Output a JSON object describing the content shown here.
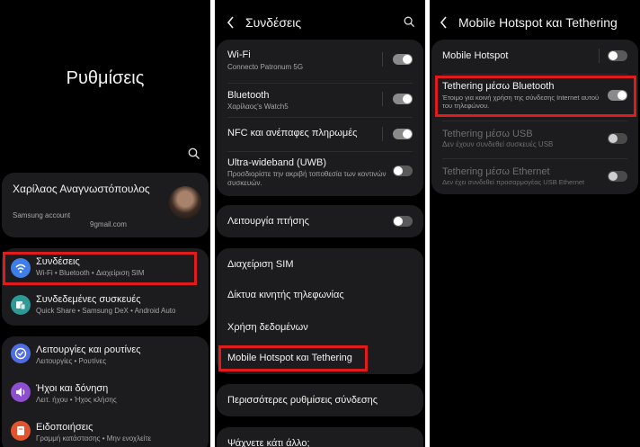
{
  "panel1": {
    "title": "Ρυθμίσεις",
    "account": {
      "name": "Χαρίλαος Αναγνωστόπουλος",
      "account_label": "Samsung account",
      "email": "9gmail.com"
    },
    "items": [
      {
        "title": "Συνδέσεις",
        "subtitle": "Wi-Fi • Bluetooth • Διαχείριση SIM",
        "icon": "wifi-icon",
        "color": "#3f7ee8"
      },
      {
        "title": "Συνδεδεμένες συσκευές",
        "subtitle": "Quick Share • Samsung DeX • Android Auto",
        "icon": "devices-icon",
        "color": "#2e9a96"
      },
      {
        "title": "Λειτουργίες και ρουτίνες",
        "subtitle": "Λειτουργίες • Ρουτίνες",
        "icon": "check-icon",
        "color": "#4f6de0"
      },
      {
        "title": "Ήχοι και δόνηση",
        "subtitle": "Λειτ. ήχου • Ήχος κλήσης",
        "icon": "sound-icon",
        "color": "#8d4fd0"
      },
      {
        "title": "Ειδοποιήσεις",
        "subtitle": "Γραμμή κατάστασης • Μην ενοχλείτε",
        "icon": "notification-icon",
        "color": "#e0542e"
      }
    ]
  },
  "panel2": {
    "header": "Συνδέσεις",
    "items": [
      {
        "title": "Wi-Fi",
        "subtitle": "Connecto Patronum 5G",
        "toggle": "on"
      },
      {
        "title": "Bluetooth",
        "subtitle": "Χαρίλαος's Watch5",
        "toggle": "on"
      },
      {
        "title": "NFC και ανέπαφες πληρωμές",
        "subtitle": "",
        "toggle": "on"
      },
      {
        "title": "Ultra-wideband (UWB)",
        "subtitle": "Προσδιορίστε την ακριβή τοποθεσία των κοντινών συσκευών.",
        "toggle": "off"
      },
      {
        "title": "Λειτουργία πτήσης",
        "subtitle": "",
        "toggle": "off"
      },
      {
        "title": "Διαχείριση SIM"
      },
      {
        "title": "Δίκτυα κινητής τηλεφωνίας"
      },
      {
        "title": "Χρήση δεδομένων"
      },
      {
        "title": "Mobile Hotspot και Tethering"
      },
      {
        "title": "Περισσότερες ρυθμίσεις σύνδεσης"
      },
      {
        "title": "Ψάχνετε κάτι άλλο;"
      }
    ]
  },
  "panel3": {
    "header": "Mobile Hotspot και Tethering",
    "items": [
      {
        "title": "Mobile Hotspot",
        "subtitle": "",
        "toggle": "off"
      },
      {
        "title": "Tethering μέσω Bluetooth",
        "subtitle": "Έτοιμο για κοινή χρήση της σύνδεσης Internet αυτού του τηλεφώνου.",
        "toggle": "on"
      },
      {
        "title": "Tethering μέσω USB",
        "subtitle": "Δεν έχουν συνδεθεί συσκευές USB",
        "toggle": "dim"
      },
      {
        "title": "Tethering μέσω Ethernet",
        "subtitle": "Δεν έχει συνδεθεί προσαρμογέας USB Ethernet",
        "toggle": "dim"
      }
    ]
  },
  "highlight_color": "#e01b1b"
}
